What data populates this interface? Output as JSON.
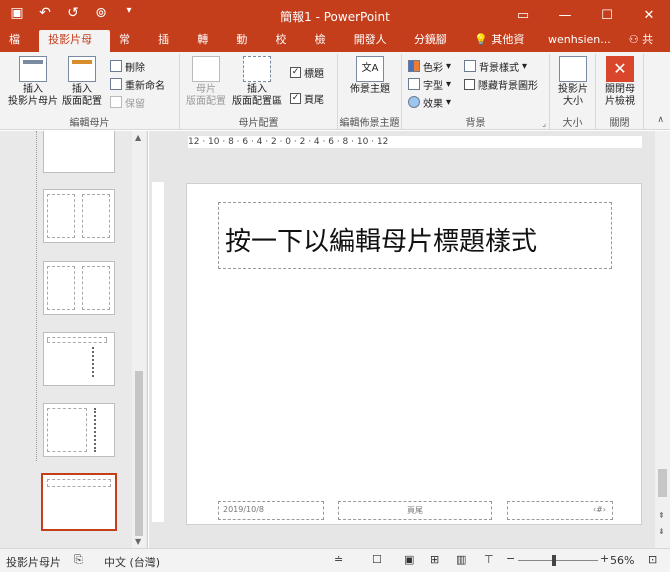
{
  "app": {
    "title": "簡報1 - PowerPoint"
  },
  "tabs": [
    "檔案",
    "投影片母片",
    "常用",
    "插入",
    "轉場",
    "動畫",
    "校閱",
    "檢視",
    "開發人員",
    "分鏡腳本"
  ],
  "tell_me": "其他資訊",
  "user": "wenhsien...",
  "share": "共用",
  "ribbon": {
    "groups": {
      "edit_master": "編輯母片",
      "master_layout": "母片配置",
      "edit_theme": "編輯佈景主題",
      "background": "背景",
      "size": "大小",
      "close": "關閉"
    },
    "insert_slide_master": "插入\n投影片母片",
    "insert_layout": "插入\n版面配置",
    "delete": "刪除",
    "rename": "重新命名",
    "preserve": "保留",
    "master_layout_btn": "母片\n版面配置",
    "insert_placeholder": "插入\n版面配置區",
    "title_cb": "標題",
    "footer_cb": "頁尾",
    "themes": "佈景主題",
    "colors": "色彩",
    "fonts": "字型",
    "effects": "效果",
    "bg_styles": "背景樣式",
    "hide_bg": "隱藏背景圖形",
    "slide_size": "投影片\n大小",
    "close_master": "關閉母\n片檢視"
  },
  "slide": {
    "title_placeholder": "按一下以編輯母片標題樣式",
    "date": "2019/10/8",
    "footer": "頁尾",
    "slide_number": "‹#›"
  },
  "ruler": {
    "h": "12 · 10 · 8 · 6 · 4 · 2 · 0 · 2 · 4 · 6 · 8 · 10 · 12"
  },
  "status": {
    "view": "投影片母片",
    "language": "中文 (台灣)",
    "zoom": "56%",
    "zoom_level": 0.56
  }
}
